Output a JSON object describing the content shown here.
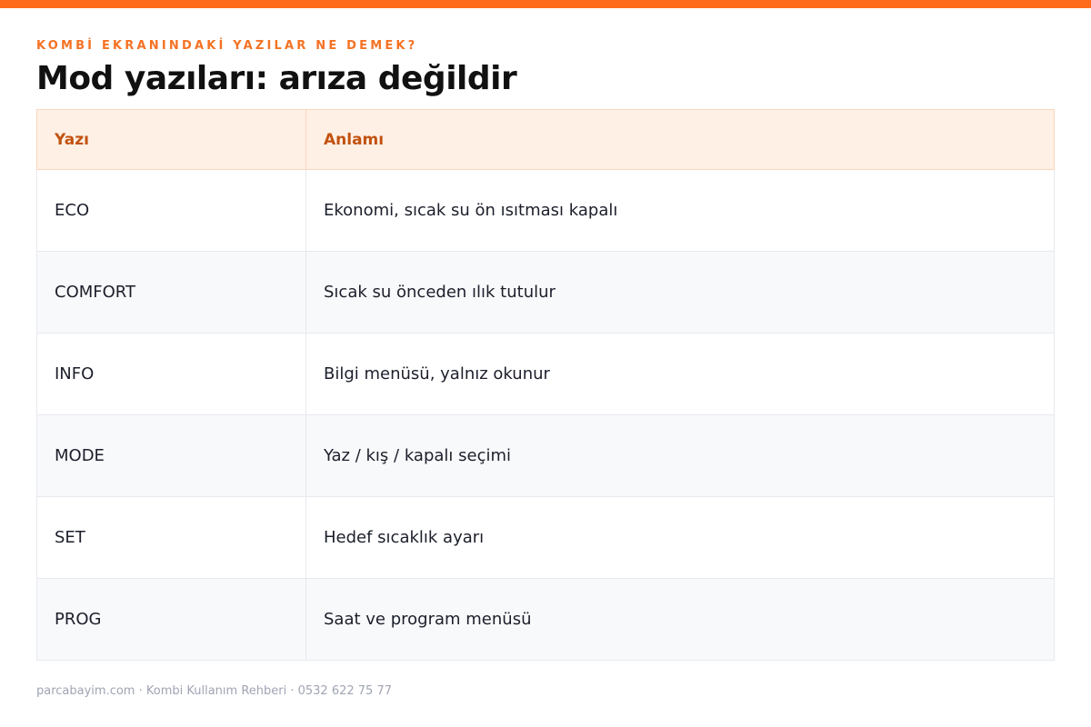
{
  "colors": {
    "accent": "#ff6b1a",
    "eyebrow": "#f57224",
    "header_bg": "#fff0e6",
    "header_text": "#c2520f"
  },
  "eyebrow": "KOMBİ EKRANINDAKİ YAZILAR NE DEMEK?",
  "title": "Mod yazıları: arıza değildir",
  "table": {
    "headers": [
      "Yazı",
      "Anlamı"
    ],
    "rows": [
      [
        "ECO",
        "Ekonomi, sıcak su ön ısıtması kapalı"
      ],
      [
        "COMFORT",
        "Sıcak su önceden ılık tutulur"
      ],
      [
        "INFO",
        "Bilgi menüsü, yalnız okunur"
      ],
      [
        "MODE",
        "Yaz / kış / kapalı seçimi"
      ],
      [
        "SET",
        "Hedef sıcaklık ayarı"
      ],
      [
        "PROG",
        "Saat ve program menüsü"
      ]
    ]
  },
  "footer": "parcabayim.com · Kombi Kullanım Rehberi · 0532 622 75 77"
}
